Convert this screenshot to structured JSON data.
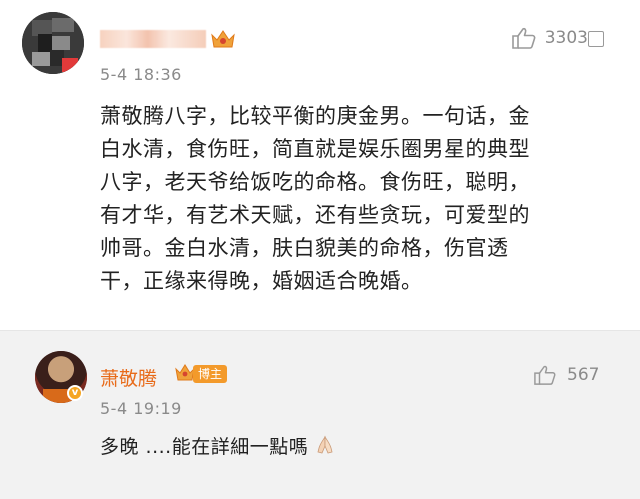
{
  "comment": {
    "username_obscured": true,
    "timestamp": "5-4 18:36",
    "likes": "3303",
    "body_lines": [
      "萧敬腾八字，比较平衡的庚金男。一句话，金",
      "白水清，食伤旺，简直就是娱乐圈男星的典型",
      "八字，老天爷给饭吃的命格。食伤旺，聪明，",
      "有才华，有艺术天赋，还有些贪玩，可爱型的",
      "帅哥。金白水清，肤白貌美的命格，伤官透",
      "干，正缘来得晚，婚姻适合晚婚。"
    ]
  },
  "reply": {
    "username": "萧敬腾",
    "badge": "博主",
    "timestamp": "5-4 19:19",
    "likes": "567",
    "text": "多晚 ....能在詳細一點嗎"
  },
  "icons": {
    "like": "thumbs-up-icon",
    "crown": "vip-crown-icon",
    "close": "close-box-icon",
    "pray": "praying-hands-emoji"
  },
  "colors": {
    "reply_name": "#e86b1a",
    "badge_bg": "#f39a2b",
    "meta_gray": "#8a8a8a"
  }
}
